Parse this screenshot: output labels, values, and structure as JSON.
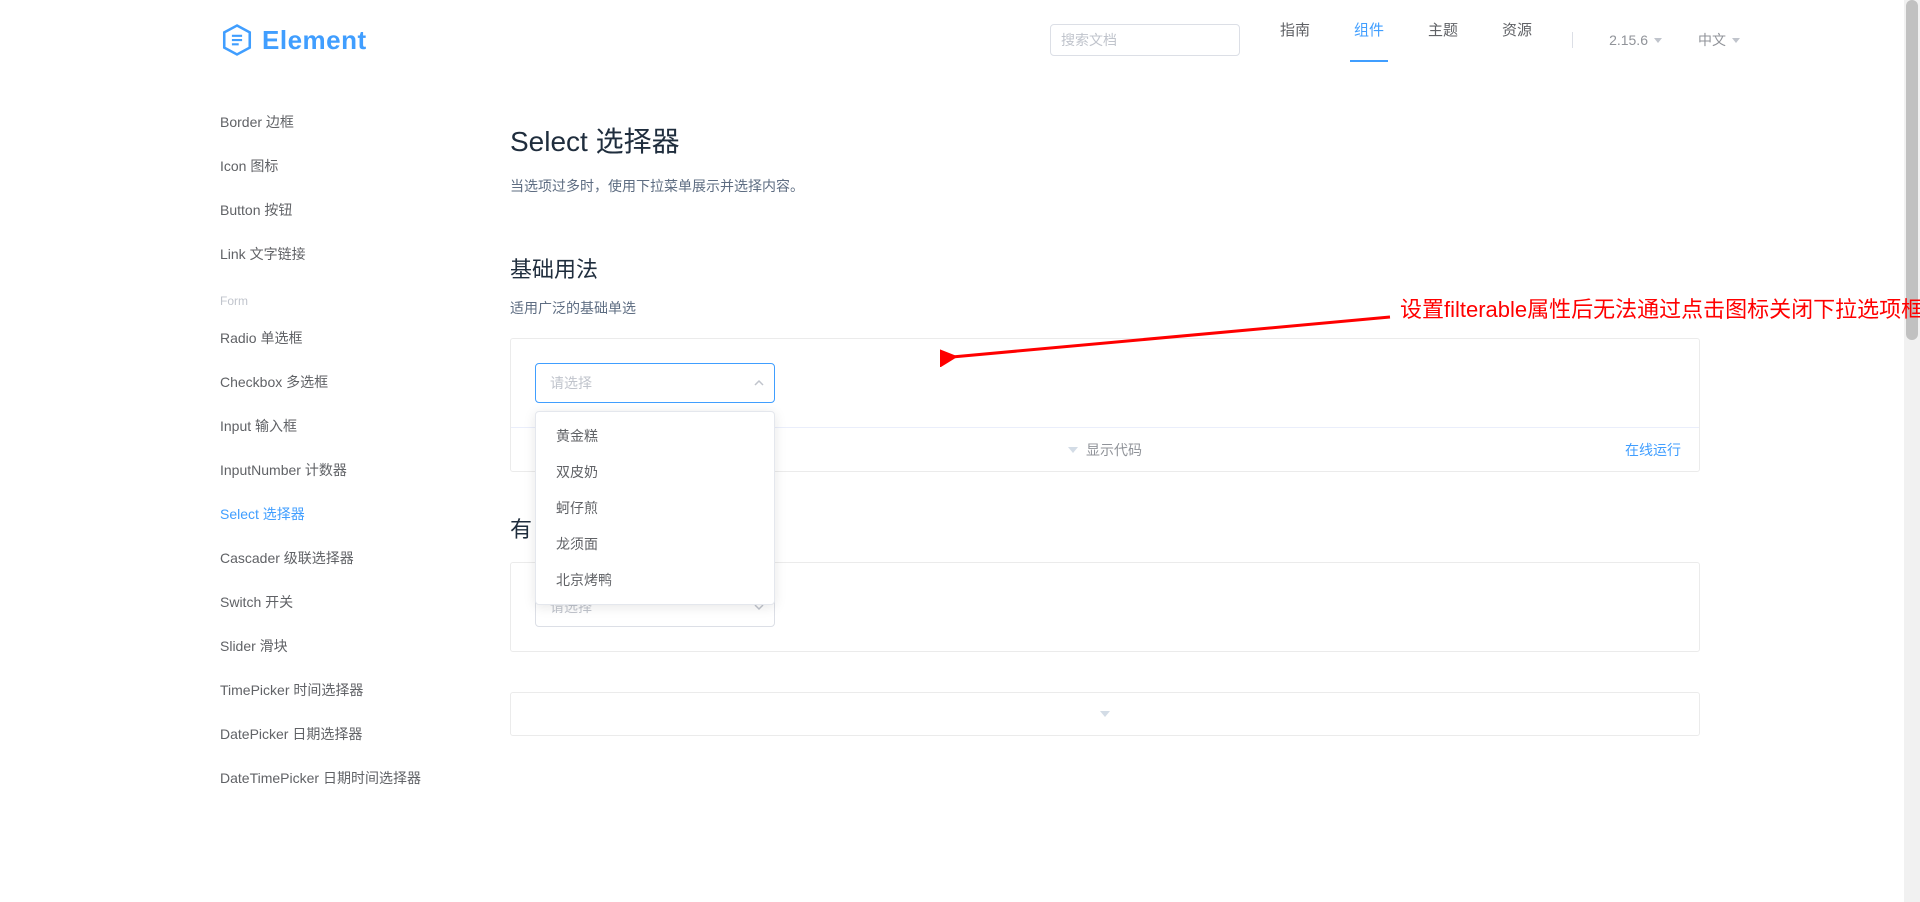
{
  "header": {
    "brand": "Element",
    "search_placeholder": "搜索文档",
    "nav": {
      "guide": "指南",
      "components": "组件",
      "theme": "主题",
      "resources": "资源",
      "active": "组件"
    },
    "version": "2.15.6",
    "language": "中文"
  },
  "sidebar": {
    "items_top": [
      "Border 边框",
      "Icon 图标",
      "Button 按钮",
      "Link 文字链接"
    ],
    "group_form": "Form",
    "items_form": [
      "Radio 单选框",
      "Checkbox 多选框",
      "Input 输入框",
      "InputNumber 计数器",
      "Select 选择器",
      "Cascader 级联选择器",
      "Switch 开关",
      "Slider 滑块",
      "TimePicker 时间选择器",
      "DatePicker 日期选择器",
      "DateTimePicker 日期时间选择器"
    ],
    "active": "Select 选择器"
  },
  "page": {
    "title": "Select 选择器",
    "desc": "当选项过多时，使用下拉菜单展示并选择内容。"
  },
  "section1": {
    "title": "基础用法",
    "desc": "适用广泛的基础单选",
    "select_placeholder": "请选择",
    "options": [
      "黄金糕",
      "双皮奶",
      "蚵仔煎",
      "龙须面",
      "北京烤鸭"
    ],
    "show_code": "显示代码",
    "run_online": "在线运行"
  },
  "section2": {
    "title_prefix": "有",
    "select_placeholder": "请选择"
  },
  "annotation": {
    "text": "设置filterable属性后无法通过点击图标关闭下拉选项框"
  }
}
